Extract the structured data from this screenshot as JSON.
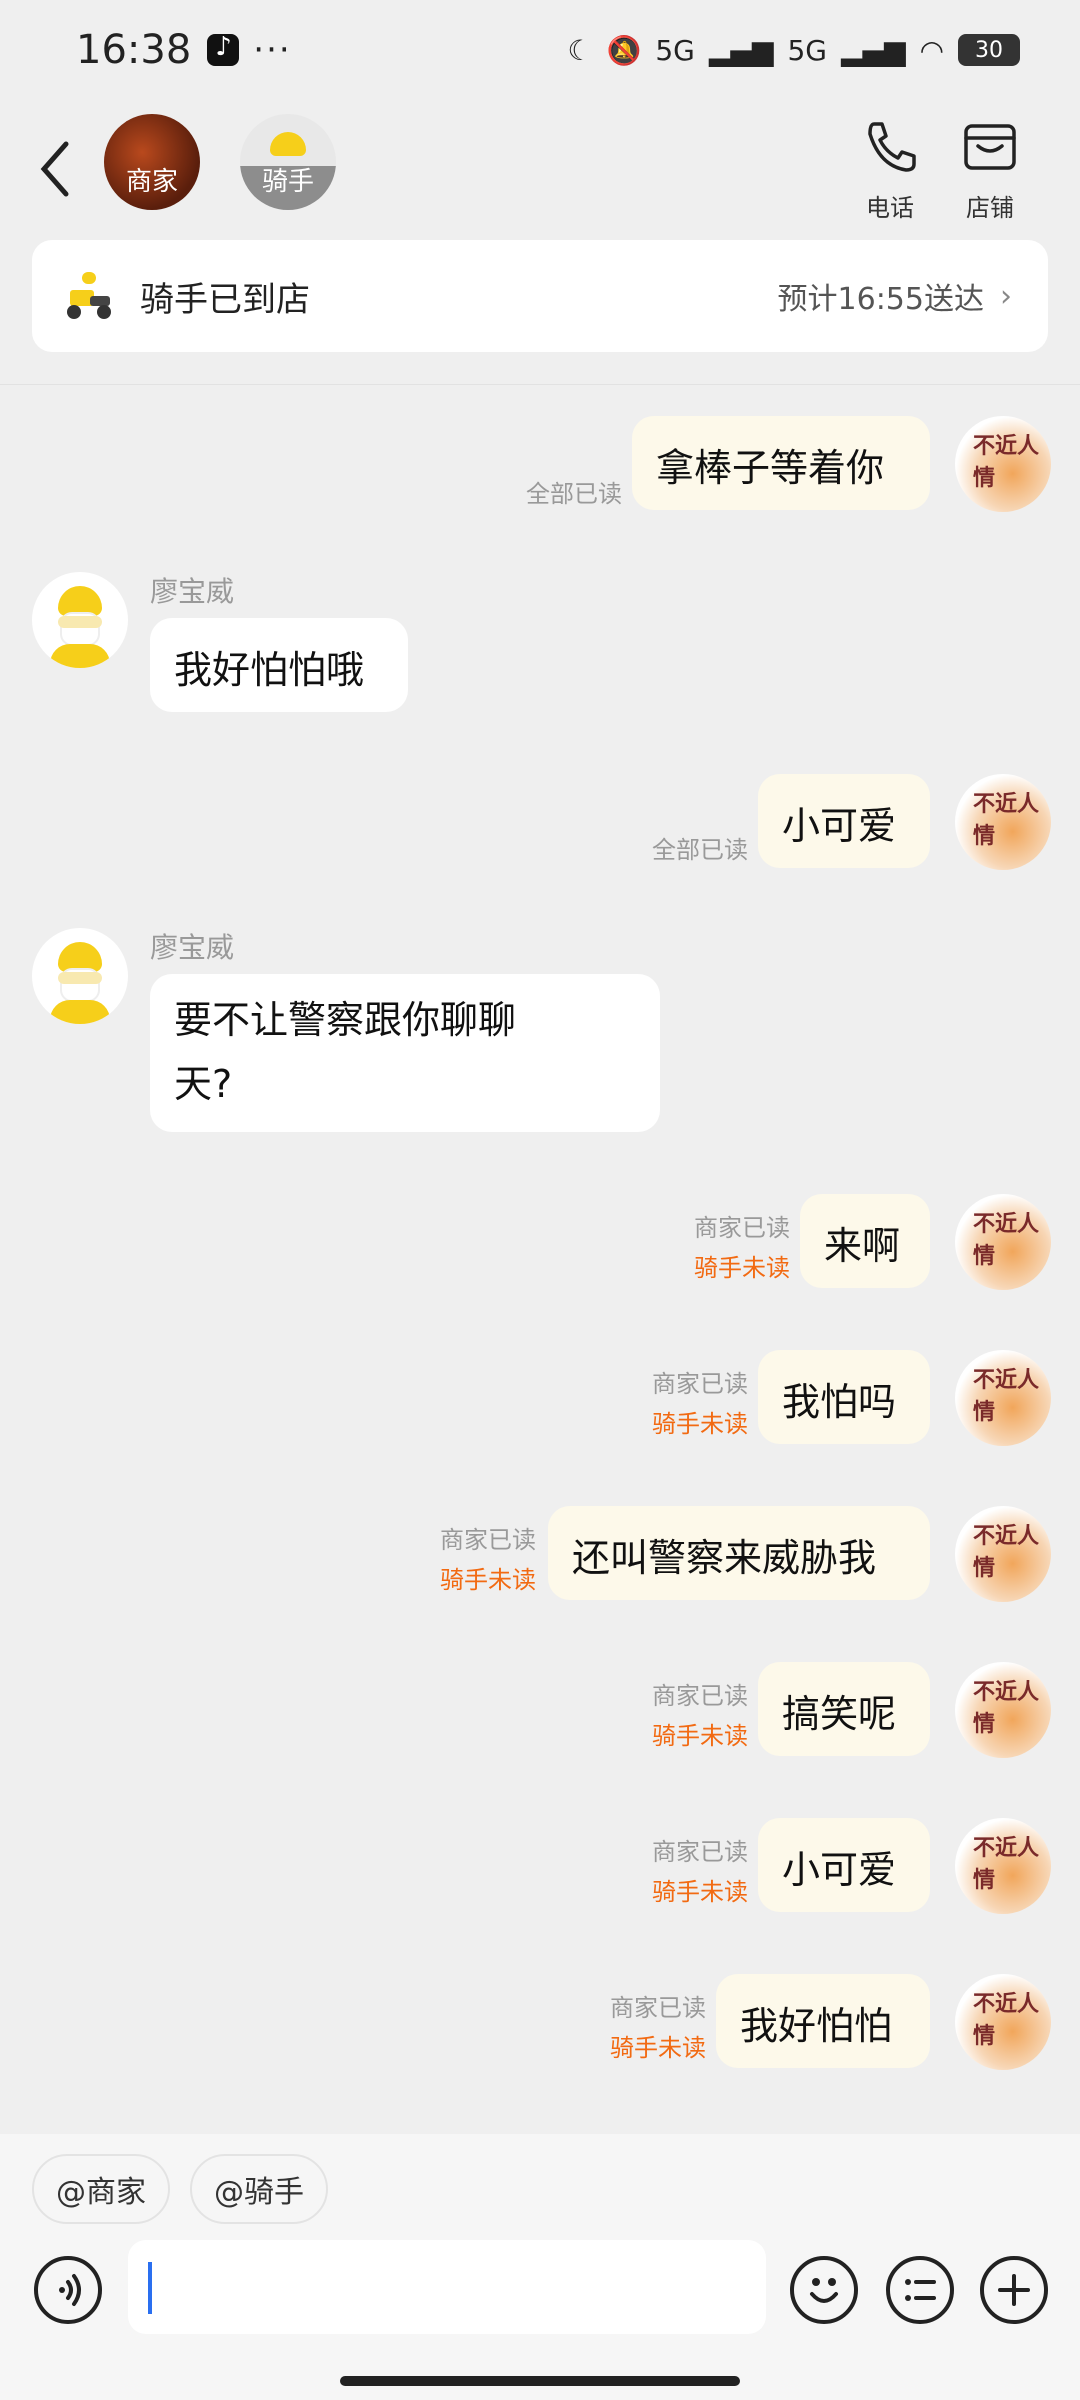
{
  "status_bar": {
    "time": "16:38",
    "dots": "···",
    "net1": "5G",
    "net2": "5G",
    "battery": "30"
  },
  "header": {
    "merchant_label": "商家",
    "rider_label": "骑手",
    "phone_label": "电话",
    "shop_label": "店铺"
  },
  "rider_card": {
    "status": "骑手已到店",
    "eta": "预计16:55送达",
    "chevron": "›"
  },
  "messages": [
    {
      "from": "me",
      "text": "拿棒子等着你",
      "read": "全部已读"
    },
    {
      "from": "rider",
      "name": "廖宝威",
      "text": "我好怕怕哦"
    },
    {
      "from": "me",
      "text": "小可爱",
      "read": "全部已读"
    },
    {
      "from": "rider",
      "name": "廖宝威",
      "text_line1": "要不让警察跟你聊聊",
      "text_line2": "天?"
    },
    {
      "from": "me",
      "text": "来啊",
      "read_merchant": "商家已读",
      "read_rider": "骑手未读"
    },
    {
      "from": "me",
      "text": "我怕吗",
      "read_merchant": "商家已读",
      "read_rider": "骑手未读"
    },
    {
      "from": "me",
      "text": "还叫警察来威胁我",
      "read_merchant": "商家已读",
      "read_rider": "骑手未读"
    },
    {
      "from": "me",
      "text": "搞笑呢",
      "read_merchant": "商家已读",
      "read_rider": "骑手未读"
    },
    {
      "from": "me",
      "text": "小可爱",
      "read_merchant": "商家已读",
      "read_rider": "骑手未读"
    },
    {
      "from": "me",
      "text": "我好怕怕",
      "read_merchant": "商家已读",
      "read_rider": "骑手未读"
    }
  ],
  "bottom": {
    "chip_merchant": "@商家",
    "chip_rider": "@骑手"
  },
  "colors": {
    "accent_unread": "#f26a12",
    "self_bubble": "#fdf9ea"
  }
}
